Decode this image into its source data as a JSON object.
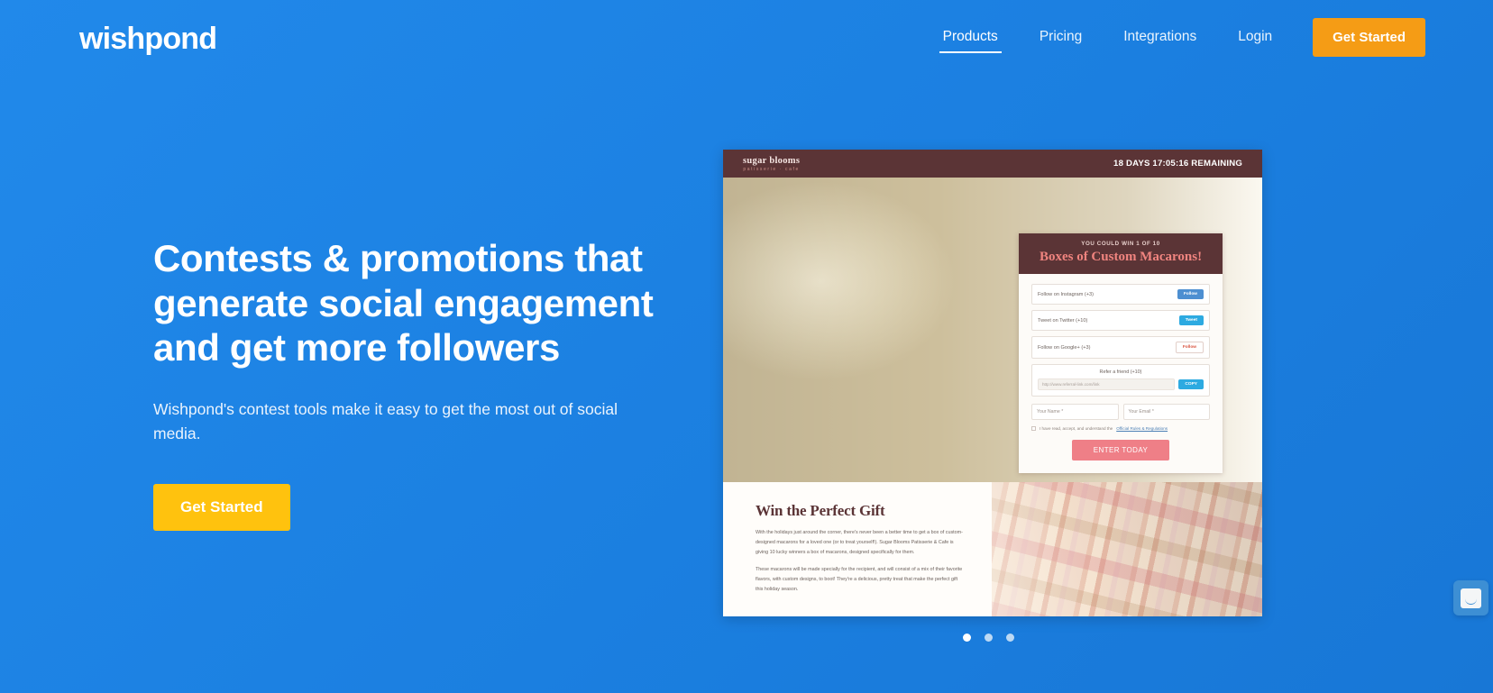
{
  "brand": {
    "logo": "wishpond"
  },
  "nav": {
    "links": [
      {
        "label": "Products",
        "active": true
      },
      {
        "label": "Pricing",
        "active": false
      },
      {
        "label": "Integrations",
        "active": false
      },
      {
        "label": "Login",
        "active": false
      }
    ],
    "cta_label": "Get Started",
    "cta_color": "#f59c15"
  },
  "hero": {
    "title": "Contests & promotions that generate social engagement and get more followers",
    "subtitle": "Wishpond's contest tools make it easy to get the most out of social media.",
    "cta_label": "Get Started",
    "cta_color": "#ffc20e",
    "background_color": "#1b84e7"
  },
  "showcase": {
    "topbar": {
      "brand_name": "sugar blooms",
      "brand_tagline": "patisserie · cafe",
      "countdown": "18 DAYS 17:05:16 REMAINING",
      "bar_color": "#5b3436"
    },
    "entry_panel": {
      "kicker": "YOU COULD WIN 1 OF 10",
      "title": "Boxes of Custom Macarons!",
      "actions": [
        {
          "label": "Follow on Instagram (+3)",
          "button": "Follow"
        },
        {
          "label": "Tweet on Twitter (+10)",
          "button": "Tweet"
        },
        {
          "label": "Follow on Google+ (+3)",
          "button": "Follow"
        }
      ],
      "refer": {
        "label": "Refer a friend (+10)",
        "url": "http://www.referral-link.com/link",
        "copy_label": "COPY"
      },
      "name_placeholder": "Your Name *",
      "email_placeholder": "Your Email *",
      "terms_text": "I have read, accept, and understand the",
      "terms_link": "Official Rules & Regulations",
      "submit_label": "ENTER TODAY",
      "submit_color": "#ef7f87"
    },
    "article": {
      "heading": "Win the Perfect Gift",
      "paragraph1": "With the holidays just around the corner, there's never been a better time to get a box of custom-designed macarons for a loved one (or to treat yourself!). Sugar Blooms Patisserie & Cafe is giving 10 lucky winners a box of macarons, designed specifically for them.",
      "paragraph2": "These macarons will be made specially for the recipient, and will consist of a mix of their favorite flavors, with custom designs, to boot! They're a delicious, pretty treat that make the perfect gift this holiday season."
    }
  },
  "carousel": {
    "slides": 3,
    "active_index": 0
  },
  "chat": {
    "label": "chat-launcher"
  }
}
